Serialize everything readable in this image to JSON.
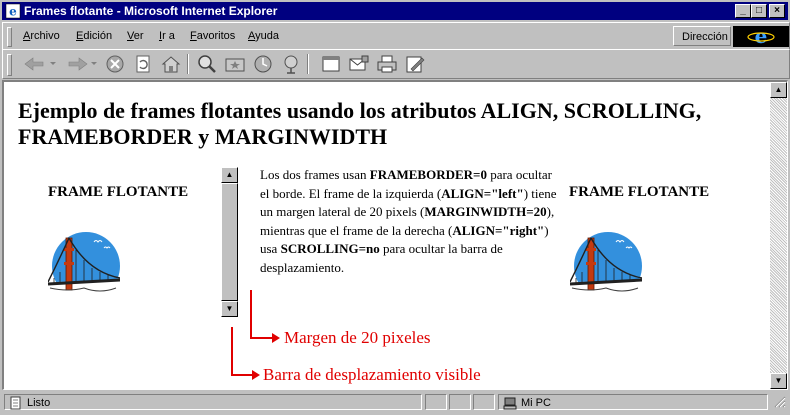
{
  "window": {
    "title": "Frames flotante - Microsoft Internet Explorer",
    "controls": {
      "minimize": "_",
      "maximize": "□",
      "close": "×"
    }
  },
  "menu": {
    "items": [
      {
        "label": "Archivo",
        "accel": "A",
        "rest": "rchivo"
      },
      {
        "label": "Edición",
        "accel": "E",
        "rest": "dición"
      },
      {
        "label": "Ver",
        "accel": "V",
        "rest": "er"
      },
      {
        "label": "Ir a",
        "accel": "I",
        "rest": "r a"
      },
      {
        "label": "Favoritos",
        "accel": "F",
        "rest": "avoritos"
      },
      {
        "label": "Ayuda",
        "accel": "A",
        "rest": "yuda"
      }
    ],
    "address_label": "Dirección"
  },
  "toolbar": {
    "buttons": [
      "back-icon",
      "forward-icon",
      "stop-icon",
      "refresh-icon",
      "home-icon",
      "search-icon",
      "favorites-icon",
      "history-icon",
      "channels-icon",
      "fullscreen-icon",
      "mail-icon",
      "print-icon",
      "edit-icon"
    ]
  },
  "page": {
    "heading": "Ejemplo de frames flotantes usando los atributos ALIGN, SCROLLING, FRAMEBORDER y MARGINWIDTH",
    "left_caption": "FRAME FLOTANTE",
    "right_caption": "FRAME FLOTANTE",
    "description": {
      "t1": "Los dos frames usan ",
      "b1": "FRAMEBORDER=0",
      "t2": " para ocultar el borde. El frame de la izquierda (",
      "b2": "ALIGN=\"left\"",
      "t3": ") tiene un margen lateral de 20 pixels (",
      "b3": "MARGINWIDTH=20",
      "t4": "), mientras que el frame de la derecha (",
      "b4": "ALIGN=\"right\"",
      "t5": ") usa ",
      "b5": "SCROLLING=no",
      "t6": " para ocultar la barra de desplazamiento."
    },
    "annotations": {
      "margin": "Margen de 20 pixeles",
      "scrollbar": "Barra de desplazamiento visible"
    },
    "annotation_color": "#e00000"
  },
  "status": {
    "text": "Listo",
    "zone": "Mi PC"
  }
}
